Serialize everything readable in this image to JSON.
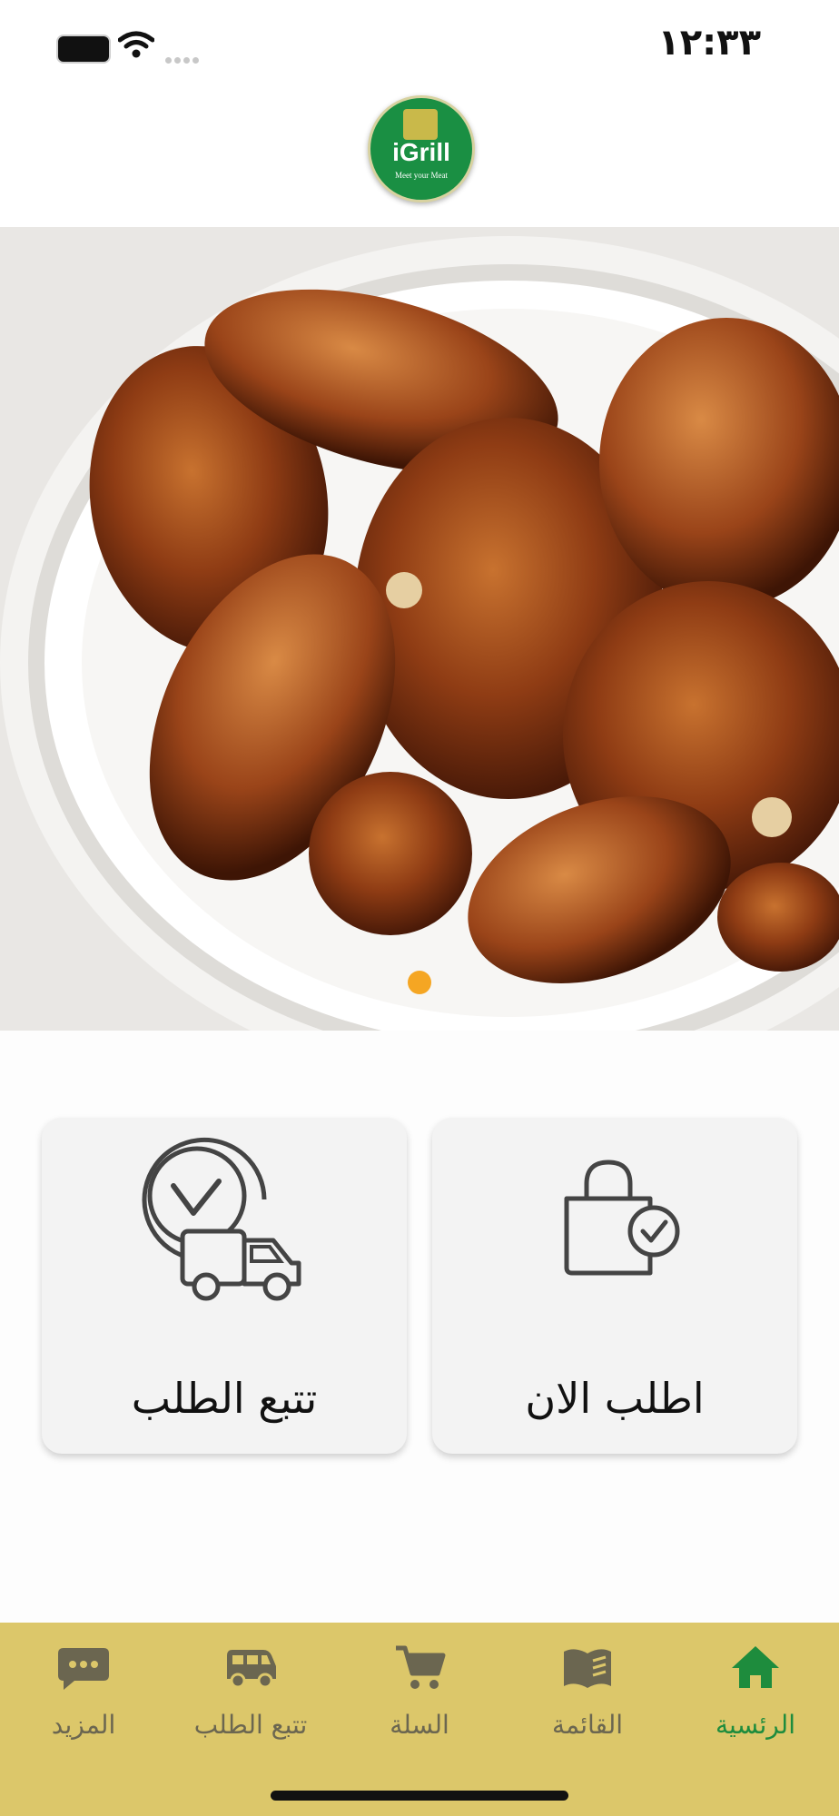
{
  "status_bar": {
    "time": "١٢:٣٣"
  },
  "header": {
    "logo_name": "iGrill",
    "logo_tagline": "Meet your Meat"
  },
  "banner": {
    "image": "grilled-chicken-photo",
    "slide_count": 1,
    "active_slide": 1,
    "dot_color": "#f5a623"
  },
  "cards": {
    "track_order_label": "تتبع الطلب",
    "order_now_label": "اطلب الان"
  },
  "bottom_nav": {
    "background": "#dcc76a",
    "active_color": "#1e8c3d",
    "items": [
      {
        "label": "المزيد",
        "icon": "more-chat-icon"
      },
      {
        "label": "تتبع الطلب",
        "icon": "van-icon"
      },
      {
        "label": "السلة",
        "icon": "cart-icon"
      },
      {
        "label": "القائمة",
        "icon": "menu-book-icon"
      },
      {
        "label": "الرئسية",
        "icon": "home-icon",
        "active": true
      }
    ]
  }
}
